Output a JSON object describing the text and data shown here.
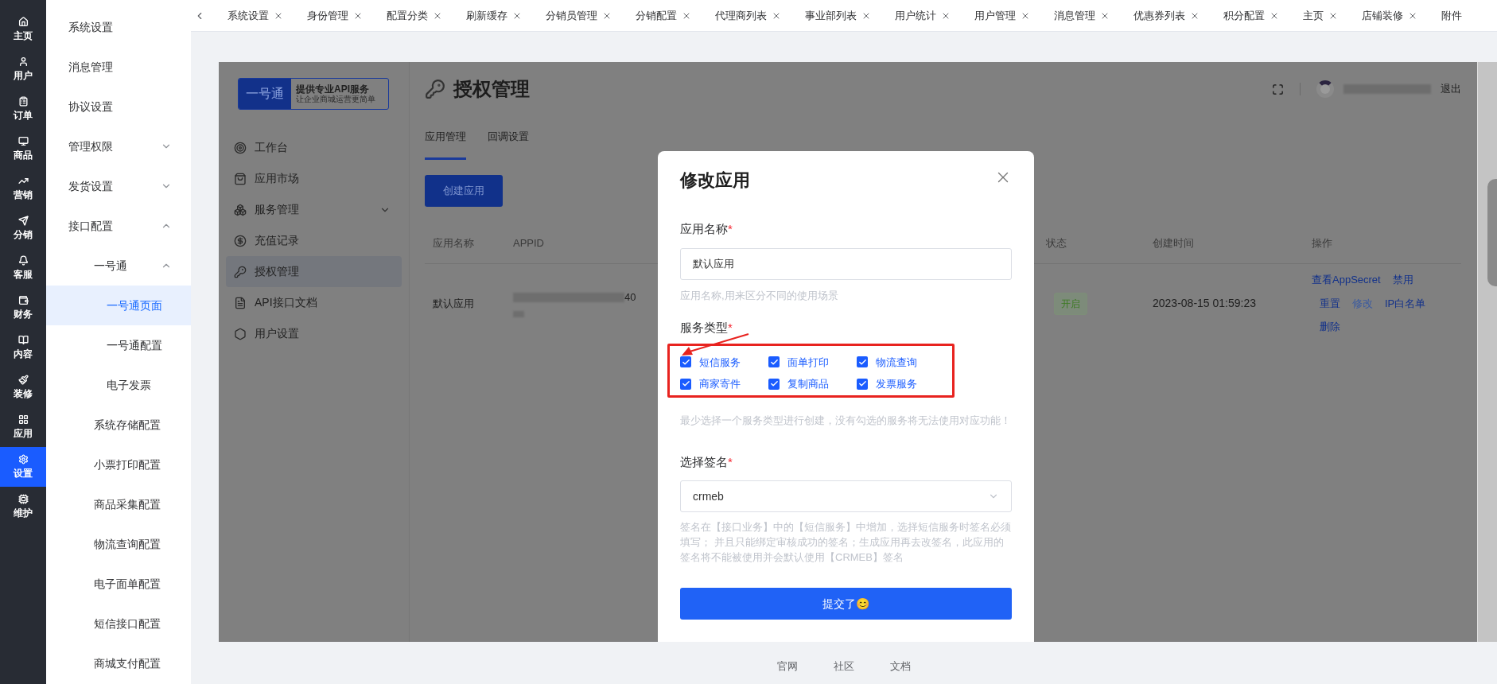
{
  "icon_rail": [
    {
      "label": "主页",
      "selected": false
    },
    {
      "label": "用户",
      "selected": false
    },
    {
      "label": "订单",
      "selected": false
    },
    {
      "label": "商品",
      "selected": false
    },
    {
      "label": "营销",
      "selected": false
    },
    {
      "label": "分销",
      "selected": false
    },
    {
      "label": "客服",
      "selected": false
    },
    {
      "label": "财务",
      "selected": false
    },
    {
      "label": "内容",
      "selected": false
    },
    {
      "label": "装修",
      "selected": false
    },
    {
      "label": "应用",
      "selected": false
    },
    {
      "label": "设置",
      "selected": true
    },
    {
      "label": "维护",
      "selected": false
    }
  ],
  "submenu": [
    {
      "label": "系统设置",
      "selected": false
    },
    {
      "label": "消息管理",
      "selected": false
    },
    {
      "label": "协议设置",
      "selected": false
    },
    {
      "label": "管理权限",
      "selected": false,
      "expanded": false
    },
    {
      "label": "发货设置",
      "selected": false,
      "expanded": false
    },
    {
      "label": "接口配置",
      "selected": false,
      "expanded": true,
      "children": [
        {
          "label": "一号通",
          "selected": false,
          "expanded": true,
          "children": [
            {
              "label": "一号通页面",
              "selected": true
            },
            {
              "label": "一号通配置",
              "selected": false
            },
            {
              "label": "电子发票",
              "selected": false
            }
          ]
        },
        {
          "label": "系统存储配置",
          "selected": false
        },
        {
          "label": "小票打印配置",
          "selected": false
        },
        {
          "label": "商品采集配置",
          "selected": false
        },
        {
          "label": "物流查询配置",
          "selected": false
        },
        {
          "label": "电子面单配置",
          "selected": false
        },
        {
          "label": "短信接口配置",
          "selected": false
        },
        {
          "label": "商城支付配置",
          "selected": false
        }
      ]
    }
  ],
  "tabs": [
    "系统设置",
    "身份管理",
    "配置分类",
    "刷新缓存",
    "分销员管理",
    "分销配置",
    "代理商列表",
    "事业部列表",
    "用户统计",
    "用户管理",
    "消息管理",
    "优惠券列表",
    "积分配置",
    "主页",
    "店铺装修",
    "附件"
  ],
  "inner": {
    "brand": {
      "name": "一号通",
      "tagline": "提供专业API服务",
      "subtitle": "让企业商城运营更简单"
    },
    "nav": [
      {
        "label": "工作台",
        "selected": false
      },
      {
        "label": "应用市场",
        "selected": false
      },
      {
        "label": "服务管理",
        "selected": false,
        "expanded": false
      },
      {
        "label": "充值记录",
        "selected": false
      },
      {
        "label": "授权管理",
        "selected": true
      },
      {
        "label": "API接口文档",
        "selected": false
      },
      {
        "label": "用户设置",
        "selected": false
      }
    ],
    "title": "授权管理",
    "logout": "退出",
    "subtabs": [
      {
        "label": "应用管理",
        "selected": true
      },
      {
        "label": "回调设置",
        "selected": false
      }
    ],
    "create_button": "创建应用",
    "table": {
      "columns": [
        "应用名称",
        "APPID",
        "状态",
        "创建时间",
        "操作"
      ],
      "rows": [
        {
          "name": "默认应用",
          "appid": "40",
          "status": "开启",
          "created": "2023-08-15 01:59:23",
          "actions": [
            "查看AppSecret",
            "禁用",
            "重置",
            "修改",
            "IP白名单",
            "删除"
          ]
        }
      ]
    }
  },
  "modal": {
    "title": "修改应用",
    "required_mark": "*",
    "name_label": "应用名称",
    "name_value": "默认应用",
    "name_hint": "应用名称,用来区分不同的使用场景",
    "services_label": "服务类型",
    "services": [
      {
        "label": "短信服务",
        "checked": true
      },
      {
        "label": "面单打印",
        "checked": true
      },
      {
        "label": "物流查询",
        "checked": true
      },
      {
        "label": "商家寄件",
        "checked": true
      },
      {
        "label": "复制商品",
        "checked": true
      },
      {
        "label": "发票服务",
        "checked": true
      }
    ],
    "services_hint": "最少选择一个服务类型进行创建，没有勾选的服务将无法使用对应功能！",
    "sign_label": "选择签名",
    "sign_value": "crmeb",
    "sign_hint": "签名在【接口业务】中的【短信服务】中增加，选择短信服务时签名必须填写； 并且只能绑定审核成功的签名；生成应用再去改签名，此应用的签名将不能被使用并会默认使用【CRMEB】签名",
    "submit": "提交了😊"
  },
  "footer": [
    "官网",
    "社区",
    "文档"
  ]
}
